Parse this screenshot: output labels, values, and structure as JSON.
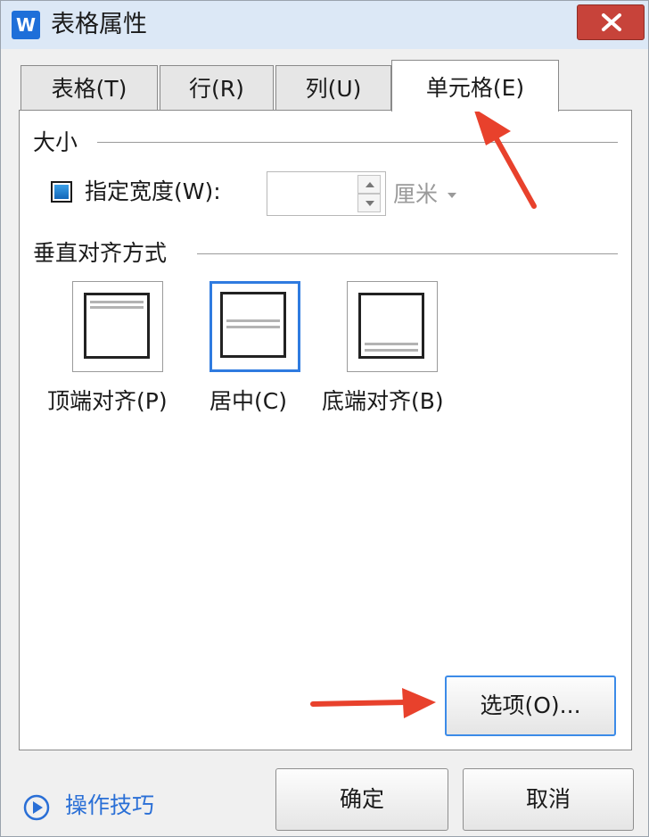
{
  "window": {
    "app_icon_letter": "W",
    "title": "表格属性",
    "colors": {
      "accent": "#2f7be0",
      "close": "#c7433a",
      "arrow": "#e8412c"
    }
  },
  "tabs": [
    {
      "label": "表格(T)",
      "active": false
    },
    {
      "label": "行(R)",
      "active": false
    },
    {
      "label": "列(U)",
      "active": false
    },
    {
      "label": "单元格(E)",
      "active": true
    }
  ],
  "size_group": {
    "label": "大小",
    "preferred_width_checkbox": {
      "label": "指定宽度(W):",
      "checked": true
    },
    "width_value": "",
    "unit": "厘米"
  },
  "valign_group": {
    "label": "垂直对齐方式",
    "options": [
      {
        "label": "顶端对齐(P)",
        "selected": false
      },
      {
        "label": "居中(C)",
        "selected": true
      },
      {
        "label": "底端对齐(B)",
        "selected": false
      }
    ]
  },
  "options_button": "选项(O)...",
  "footer": {
    "tips": "操作技巧",
    "ok": "确定",
    "cancel": "取消"
  }
}
